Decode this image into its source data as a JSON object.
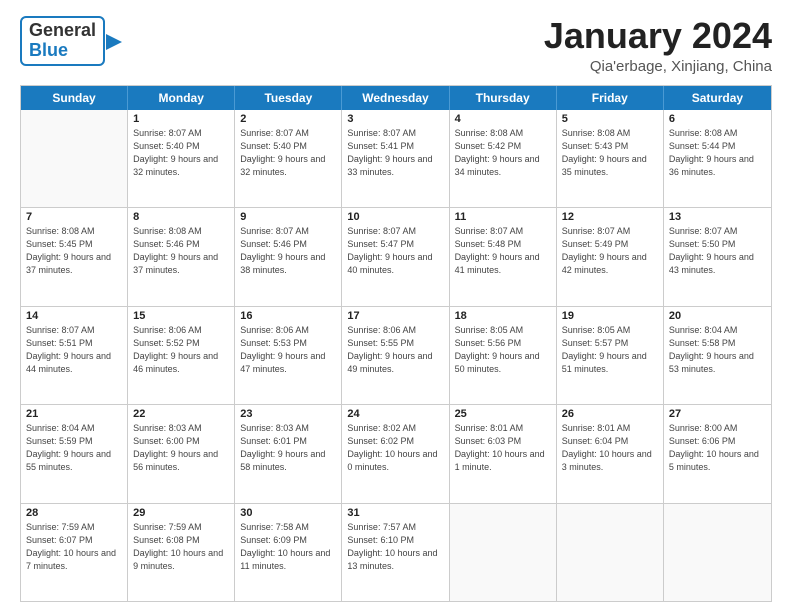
{
  "header": {
    "logo_general": "General",
    "logo_blue": "Blue",
    "month_title": "January 2024",
    "location": "Qia'erbage, Xinjiang, China"
  },
  "weekdays": [
    "Sunday",
    "Monday",
    "Tuesday",
    "Wednesday",
    "Thursday",
    "Friday",
    "Saturday"
  ],
  "weeks": [
    [
      {
        "day": "",
        "sunrise": "",
        "sunset": "",
        "daylight": ""
      },
      {
        "day": "1",
        "sunrise": "Sunrise: 8:07 AM",
        "sunset": "Sunset: 5:40 PM",
        "daylight": "Daylight: 9 hours and 32 minutes."
      },
      {
        "day": "2",
        "sunrise": "Sunrise: 8:07 AM",
        "sunset": "Sunset: 5:40 PM",
        "daylight": "Daylight: 9 hours and 32 minutes."
      },
      {
        "day": "3",
        "sunrise": "Sunrise: 8:07 AM",
        "sunset": "Sunset: 5:41 PM",
        "daylight": "Daylight: 9 hours and 33 minutes."
      },
      {
        "day": "4",
        "sunrise": "Sunrise: 8:08 AM",
        "sunset": "Sunset: 5:42 PM",
        "daylight": "Daylight: 9 hours and 34 minutes."
      },
      {
        "day": "5",
        "sunrise": "Sunrise: 8:08 AM",
        "sunset": "Sunset: 5:43 PM",
        "daylight": "Daylight: 9 hours and 35 minutes."
      },
      {
        "day": "6",
        "sunrise": "Sunrise: 8:08 AM",
        "sunset": "Sunset: 5:44 PM",
        "daylight": "Daylight: 9 hours and 36 minutes."
      }
    ],
    [
      {
        "day": "7",
        "sunrise": "Sunrise: 8:08 AM",
        "sunset": "Sunset: 5:45 PM",
        "daylight": "Daylight: 9 hours and 37 minutes."
      },
      {
        "day": "8",
        "sunrise": "Sunrise: 8:08 AM",
        "sunset": "Sunset: 5:46 PM",
        "daylight": "Daylight: 9 hours and 37 minutes."
      },
      {
        "day": "9",
        "sunrise": "Sunrise: 8:07 AM",
        "sunset": "Sunset: 5:46 PM",
        "daylight": "Daylight: 9 hours and 38 minutes."
      },
      {
        "day": "10",
        "sunrise": "Sunrise: 8:07 AM",
        "sunset": "Sunset: 5:47 PM",
        "daylight": "Daylight: 9 hours and 40 minutes."
      },
      {
        "day": "11",
        "sunrise": "Sunrise: 8:07 AM",
        "sunset": "Sunset: 5:48 PM",
        "daylight": "Daylight: 9 hours and 41 minutes."
      },
      {
        "day": "12",
        "sunrise": "Sunrise: 8:07 AM",
        "sunset": "Sunset: 5:49 PM",
        "daylight": "Daylight: 9 hours and 42 minutes."
      },
      {
        "day": "13",
        "sunrise": "Sunrise: 8:07 AM",
        "sunset": "Sunset: 5:50 PM",
        "daylight": "Daylight: 9 hours and 43 minutes."
      }
    ],
    [
      {
        "day": "14",
        "sunrise": "Sunrise: 8:07 AM",
        "sunset": "Sunset: 5:51 PM",
        "daylight": "Daylight: 9 hours and 44 minutes."
      },
      {
        "day": "15",
        "sunrise": "Sunrise: 8:06 AM",
        "sunset": "Sunset: 5:52 PM",
        "daylight": "Daylight: 9 hours and 46 minutes."
      },
      {
        "day": "16",
        "sunrise": "Sunrise: 8:06 AM",
        "sunset": "Sunset: 5:53 PM",
        "daylight": "Daylight: 9 hours and 47 minutes."
      },
      {
        "day": "17",
        "sunrise": "Sunrise: 8:06 AM",
        "sunset": "Sunset: 5:55 PM",
        "daylight": "Daylight: 9 hours and 49 minutes."
      },
      {
        "day": "18",
        "sunrise": "Sunrise: 8:05 AM",
        "sunset": "Sunset: 5:56 PM",
        "daylight": "Daylight: 9 hours and 50 minutes."
      },
      {
        "day": "19",
        "sunrise": "Sunrise: 8:05 AM",
        "sunset": "Sunset: 5:57 PM",
        "daylight": "Daylight: 9 hours and 51 minutes."
      },
      {
        "day": "20",
        "sunrise": "Sunrise: 8:04 AM",
        "sunset": "Sunset: 5:58 PM",
        "daylight": "Daylight: 9 hours and 53 minutes."
      }
    ],
    [
      {
        "day": "21",
        "sunrise": "Sunrise: 8:04 AM",
        "sunset": "Sunset: 5:59 PM",
        "daylight": "Daylight: 9 hours and 55 minutes."
      },
      {
        "day": "22",
        "sunrise": "Sunrise: 8:03 AM",
        "sunset": "Sunset: 6:00 PM",
        "daylight": "Daylight: 9 hours and 56 minutes."
      },
      {
        "day": "23",
        "sunrise": "Sunrise: 8:03 AM",
        "sunset": "Sunset: 6:01 PM",
        "daylight": "Daylight: 9 hours and 58 minutes."
      },
      {
        "day": "24",
        "sunrise": "Sunrise: 8:02 AM",
        "sunset": "Sunset: 6:02 PM",
        "daylight": "Daylight: 10 hours and 0 minutes."
      },
      {
        "day": "25",
        "sunrise": "Sunrise: 8:01 AM",
        "sunset": "Sunset: 6:03 PM",
        "daylight": "Daylight: 10 hours and 1 minute."
      },
      {
        "day": "26",
        "sunrise": "Sunrise: 8:01 AM",
        "sunset": "Sunset: 6:04 PM",
        "daylight": "Daylight: 10 hours and 3 minutes."
      },
      {
        "day": "27",
        "sunrise": "Sunrise: 8:00 AM",
        "sunset": "Sunset: 6:06 PM",
        "daylight": "Daylight: 10 hours and 5 minutes."
      }
    ],
    [
      {
        "day": "28",
        "sunrise": "Sunrise: 7:59 AM",
        "sunset": "Sunset: 6:07 PM",
        "daylight": "Daylight: 10 hours and 7 minutes."
      },
      {
        "day": "29",
        "sunrise": "Sunrise: 7:59 AM",
        "sunset": "Sunset: 6:08 PM",
        "daylight": "Daylight: 10 hours and 9 minutes."
      },
      {
        "day": "30",
        "sunrise": "Sunrise: 7:58 AM",
        "sunset": "Sunset: 6:09 PM",
        "daylight": "Daylight: 10 hours and 11 minutes."
      },
      {
        "day": "31",
        "sunrise": "Sunrise: 7:57 AM",
        "sunset": "Sunset: 6:10 PM",
        "daylight": "Daylight: 10 hours and 13 minutes."
      },
      {
        "day": "",
        "sunrise": "",
        "sunset": "",
        "daylight": ""
      },
      {
        "day": "",
        "sunrise": "",
        "sunset": "",
        "daylight": ""
      },
      {
        "day": "",
        "sunrise": "",
        "sunset": "",
        "daylight": ""
      }
    ]
  ]
}
